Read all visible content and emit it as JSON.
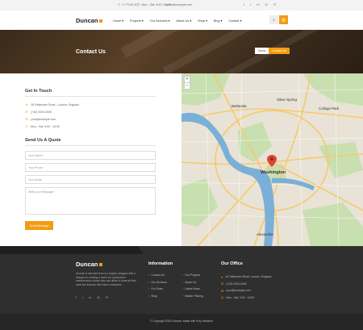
{
  "topbar": {
    "phone": "1-779-87-877",
    "hours": "Mon - Sat: 9:00 - 18:00",
    "email": "your@example.com",
    "social_icons": [
      "facebook-icon",
      "twitter-icon",
      "linkedin-icon",
      "instagram-icon",
      "pinterest-icon"
    ]
  },
  "header": {
    "logo": "Duncan",
    "nav": [
      "Home",
      "Projects",
      "Our Services",
      "About Us",
      "Shop",
      "Blog",
      "Contact"
    ]
  },
  "hero": {
    "title": "Contact Us",
    "breadcrumb_home": "Home",
    "breadcrumb_current": "Contact Us"
  },
  "contact": {
    "title": "Get In Touch",
    "address": "16 Tottenham Road , London, England",
    "phone": "(+32) 0000-0000",
    "email": "your@example.com",
    "hours": "Mon - Sat: 9:00 - 18:00"
  },
  "quote": {
    "title": "Send Us A Quote",
    "name_placeholder": "Your Name*",
    "phone_placeholder": "Your Phone",
    "email_placeholder": "Your Email",
    "message_placeholder": "Write your Message*",
    "send_label": "Send Message"
  },
  "map": {
    "zoom_in": "+",
    "zoom_out": "−",
    "labels": {
      "bethesda": "Bethesda",
      "silver_spring": "Silver Spring",
      "college_park": "College Park",
      "washington": "Washington",
      "alexandria": "Alexandria"
    },
    "colors": {
      "land": "#e8e3d6",
      "water": "#7ab0d8",
      "park": "#c8dfb0",
      "road": "#f6c96b"
    }
  },
  "footer": {
    "logo": "Duncan",
    "about": "Duncan is intended from our budget, designer with a thought on creating a home for construction entrepreneurs whose they can utilize to show all their work and impress their future customers.",
    "info_title": "Information",
    "info_col1": [
      "Contact Us",
      "Our Services",
      "Our Team",
      "Shop"
    ],
    "info_col2": [
      "Our Projects",
      "About Us",
      "Latest News",
      "Master Planing"
    ],
    "office_title": "Our Office",
    "office_address": "16 Tottenham Road, London, England.",
    "office_phone": "(+32) 0000-0000",
    "office_email": "your@example.com",
    "office_hours": "Mon - Sat: 9:00 - 18:00",
    "copyright": "© Copyright 2019 Duncan. Made with ♥ by Haintech"
  },
  "colors": {
    "accent": "#f39c12",
    "footer_bg": "#2f2f2f",
    "dark": "#262626"
  }
}
